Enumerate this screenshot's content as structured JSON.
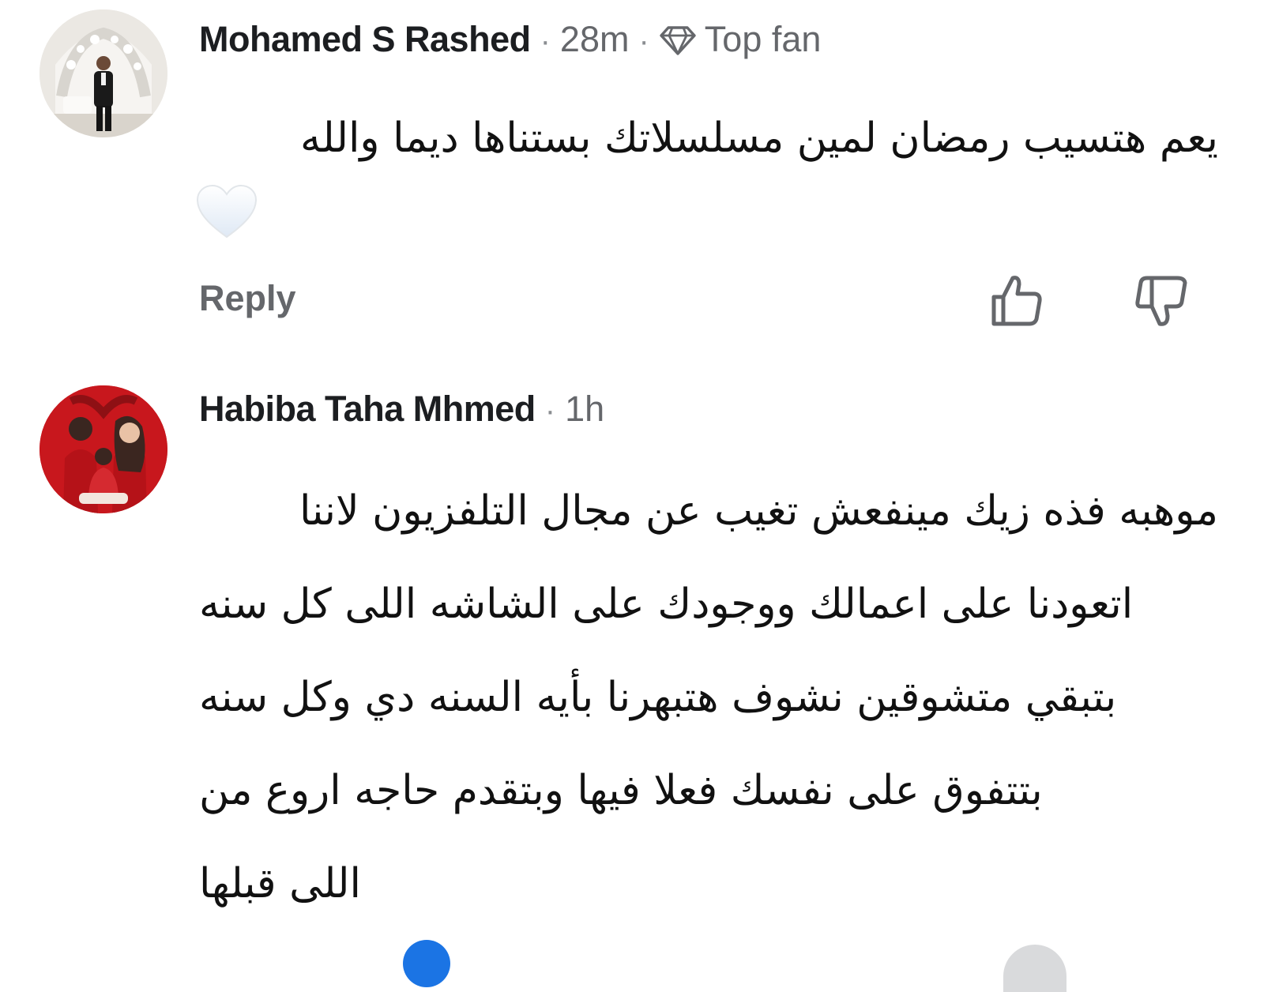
{
  "comments": [
    {
      "author": "Mohamed S Rashed",
      "time": "28m",
      "badge_icon": "diamond-icon",
      "badge": "Top fan",
      "text_lines": [
        "يعم هتسيب رمضان لمين مسلسلاتك بستناها ديما والله"
      ],
      "reaction_icon": "white-heart-icon",
      "reply_label": "Reply",
      "like_icon": "thumbs-up-icon",
      "dislike_icon": "thumbs-down-icon"
    },
    {
      "author": "Habiba Taha Mhmed",
      "time": "1h",
      "text_lines": [
        "موهبه فذه زيك مينفعش تغيب عن مجال التلفزيون لاننا",
        "اتعودنا على اعمالك ووجودك على الشاشه اللى كل سنه",
        "بتبقي متشوقين نشوف هتبهرنا بأيه السنه دي وكل سنه",
        "بتتفوق على نفسك فعلا فيها وبتقدم حاجه اروع من",
        "اللى قبلها"
      ]
    }
  ],
  "colors": {
    "name": "#1c1e21",
    "secondary": "#65676b",
    "avatar2_bg": "#c4161c"
  }
}
